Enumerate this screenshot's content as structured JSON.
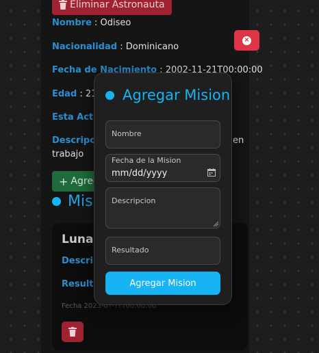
{
  "background": {
    "delete_astronaut_label": "Eliminar Astronauta",
    "fields": [
      {
        "label": "Nombre",
        "value": "Odiseo"
      },
      {
        "label": "Nacionalidad",
        "value": "Dominicano"
      },
      {
        "label": "Fecha de Nacimiento",
        "value": "2002-11-21T00:00:00"
      },
      {
        "label": "Edad",
        "value": "21"
      },
      {
        "label": "Esta Activ",
        "value": ""
      },
      {
        "label": "Descripci",
        "value": ""
      }
    ],
    "description_tail": "en",
    "description_line2": "trabajo",
    "add_mission_label": "Agreg",
    "missions_heading": "Misi",
    "mission_card": {
      "title": "Luna",
      "description_label": "Descrip",
      "result_label": "Resulta",
      "date_text": "Fecha 2023-0?-??T00:00:00"
    }
  },
  "modal": {
    "title": "Agregar Mision",
    "name_placeholder": "Nombre",
    "date_label": "Fecha de la Mision",
    "date_value": "mm/dd/yyyy",
    "description_placeholder": "Descripcion",
    "result_placeholder": "Resultado",
    "submit_label": "Agregar Mision"
  },
  "icons": {
    "close": "x-circle-icon",
    "trash": "trash-icon",
    "plus": "plus-icon",
    "calendar": "calendar-icon"
  },
  "colors": {
    "accent": "#16b4f5",
    "danger": "#dc3545",
    "success": "#1f6b3c",
    "label": "#2a8fd0"
  }
}
